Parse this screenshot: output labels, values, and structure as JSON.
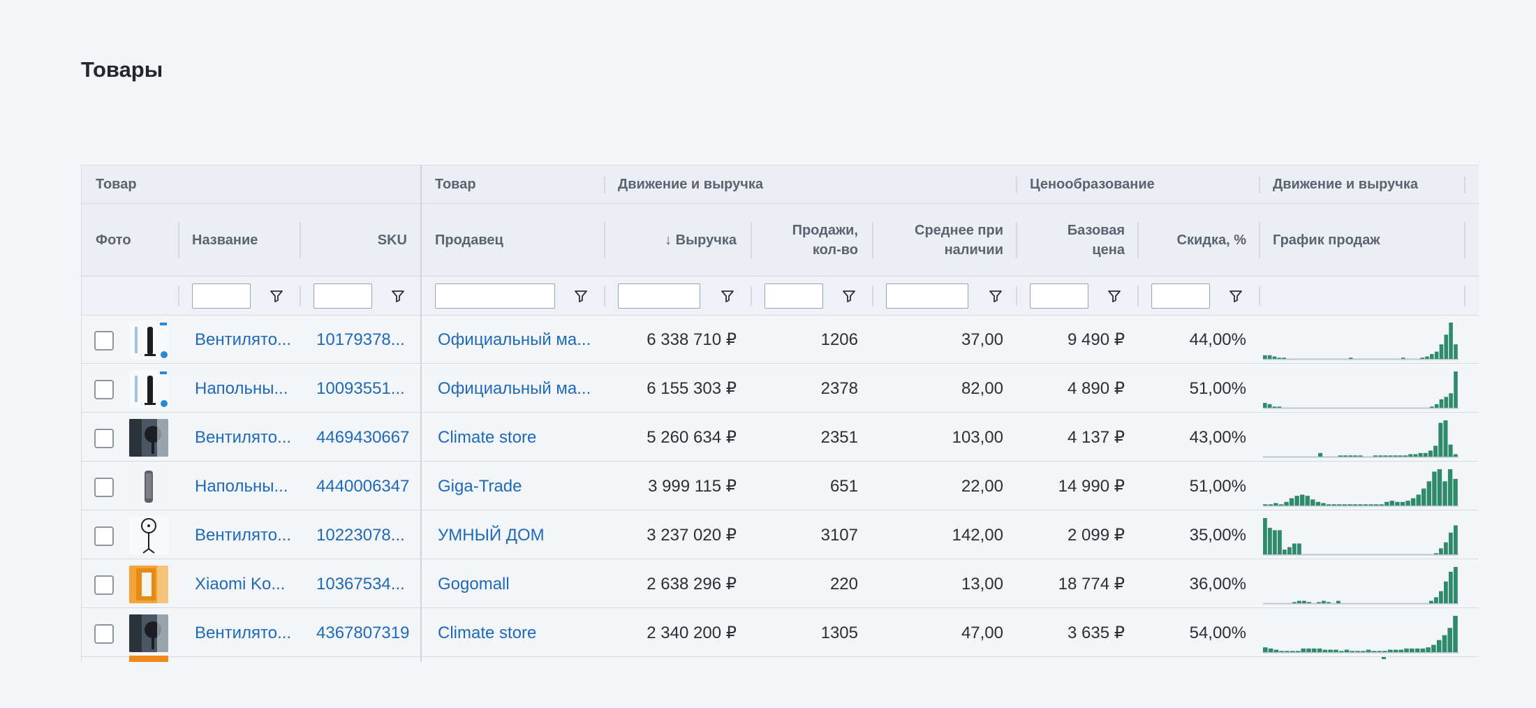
{
  "page": {
    "title": "Товары"
  },
  "groups": [
    "Товар",
    "Товар",
    "Движение и выручка",
    "Ценообразование",
    "Движение и выручка"
  ],
  "columns": {
    "photo": "Фото",
    "name": "Название",
    "sku": "SKU",
    "seller": "Продавец",
    "revenue": "↓ Выручка",
    "sales_qty_1": "Продажи,",
    "sales_qty_2": "кол-во",
    "avg_1": "Среднее при",
    "avg_2": "наличии",
    "base_price_1": "Базовая",
    "base_price_2": "цена",
    "discount": "Скидка, %",
    "chart": "График продаж"
  },
  "colors": {
    "accent": "#1e6ab8",
    "spark": "#2e8b6a",
    "header_bg": "#ebeef3",
    "page_bg": "#f3f5f8"
  },
  "rows": [
    {
      "name": "Вентилято...",
      "sku": "10179378...",
      "seller": "Официальный ма...",
      "revenue": "6 338 710 ₽",
      "qty": "1206",
      "avg": "37,00",
      "price": "9 490 ₽",
      "discount": "44,00%",
      "thumb_icon": "tower-fan-icon",
      "sales": [
        3,
        3,
        2,
        1,
        1,
        0,
        0,
        0,
        0,
        0,
        0,
        0,
        0,
        0,
        0,
        0,
        0,
        0,
        1,
        0,
        0,
        0,
        0,
        0,
        0,
        0,
        0,
        0,
        0,
        1,
        0,
        0,
        0,
        1,
        2,
        4,
        6,
        12,
        20,
        30,
        12
      ]
    },
    {
      "name": "Напольны...",
      "sku": "10093551...",
      "seller": "Официальный ма...",
      "revenue": "6 155 303 ₽",
      "qty": "2378",
      "avg": "82,00",
      "price": "4 890 ₽",
      "discount": "51,00%",
      "thumb_icon": "tower-fan-icon",
      "sales": [
        4,
        3,
        1,
        1,
        0,
        0,
        0,
        0,
        0,
        0,
        0,
        0,
        0,
        0,
        0,
        0,
        0,
        0,
        0,
        0,
        0,
        0,
        0,
        0,
        0,
        0,
        0,
        0,
        0,
        0,
        0,
        0,
        0,
        0,
        0,
        1,
        3,
        7,
        9,
        12,
        30
      ]
    },
    {
      "name": "Вентилято...",
      "sku": "4469430667",
      "seller": "Climate store",
      "revenue": "5 260 634 ₽",
      "qty": "2351",
      "avg": "103,00",
      "price": "4 137 ₽",
      "discount": "43,00%",
      "thumb_icon": "fan-photo-icon",
      "sales": [
        0,
        0,
        0,
        0,
        0,
        0,
        0,
        0,
        0,
        0,
        0,
        3,
        0,
        0,
        0,
        1,
        1,
        1,
        1,
        1,
        0,
        0,
        1,
        1,
        1,
        1,
        1,
        1,
        1,
        2,
        2,
        3,
        3,
        5,
        9,
        28,
        30,
        10,
        2
      ]
    },
    {
      "name": "Напольны...",
      "sku": "4440006347",
      "seller": "Giga-Trade",
      "revenue": "3 999 115 ₽",
      "qty": "651",
      "avg": "22,00",
      "price": "14 990 ₽",
      "discount": "51,00%",
      "thumb_icon": "column-fan-icon",
      "sales": [
        1,
        1,
        2,
        1,
        3,
        6,
        8,
        9,
        8,
        5,
        3,
        2,
        1,
        1,
        1,
        1,
        1,
        1,
        1,
        1,
        1,
        1,
        1,
        3,
        4,
        3,
        3,
        4,
        6,
        9,
        14,
        20,
        28,
        30,
        20,
        30,
        22
      ]
    },
    {
      "name": "Вентилято...",
      "sku": "10223078...",
      "seller": "УМНЫЙ ДОМ",
      "revenue": "3 237 020 ₽",
      "qty": "3107",
      "avg": "142,00",
      "price": "2 099 ₽",
      "discount": "35,00%",
      "thumb_icon": "pedestal-fan-icon",
      "sales": [
        30,
        22,
        20,
        20,
        4,
        6,
        9,
        9,
        0,
        0,
        0,
        0,
        0,
        0,
        0,
        0,
        0,
        0,
        0,
        0,
        0,
        0,
        0,
        0,
        0,
        0,
        0,
        0,
        0,
        0,
        0,
        0,
        0,
        0,
        0,
        1,
        5,
        10,
        18,
        24
      ]
    },
    {
      "name": "Xiaomi Ko...",
      "sku": "10367534...",
      "seller": "Gogomall",
      "revenue": "2 638 296 ₽",
      "qty": "220",
      "avg": "13,00",
      "price": "18 774 ₽",
      "discount": "36,00%",
      "thumb_icon": "box-fan-icon",
      "sales": [
        0,
        0,
        0,
        0,
        0,
        0,
        1,
        2,
        2,
        1,
        0,
        1,
        2,
        1,
        0,
        2,
        0,
        0,
        0,
        0,
        0,
        0,
        0,
        0,
        0,
        0,
        0,
        0,
        0,
        0,
        0,
        0,
        0,
        0,
        2,
        5,
        10,
        18,
        26,
        30
      ]
    },
    {
      "name": "Вентилято...",
      "sku": "4367807319",
      "seller": "Climate store",
      "revenue": "2 340 200 ₽",
      "qty": "1305",
      "avg": "47,00",
      "price": "3 635 ₽",
      "discount": "54,00%",
      "thumb_icon": "fan-photo-icon",
      "sales": [
        4,
        3,
        2,
        1,
        1,
        1,
        1,
        3,
        3,
        3,
        3,
        2,
        2,
        2,
        1,
        2,
        1,
        1,
        1,
        2,
        1,
        1,
        1,
        2,
        2,
        2,
        3,
        3,
        3,
        3,
        4,
        6,
        10,
        14,
        20,
        30
      ]
    }
  ]
}
